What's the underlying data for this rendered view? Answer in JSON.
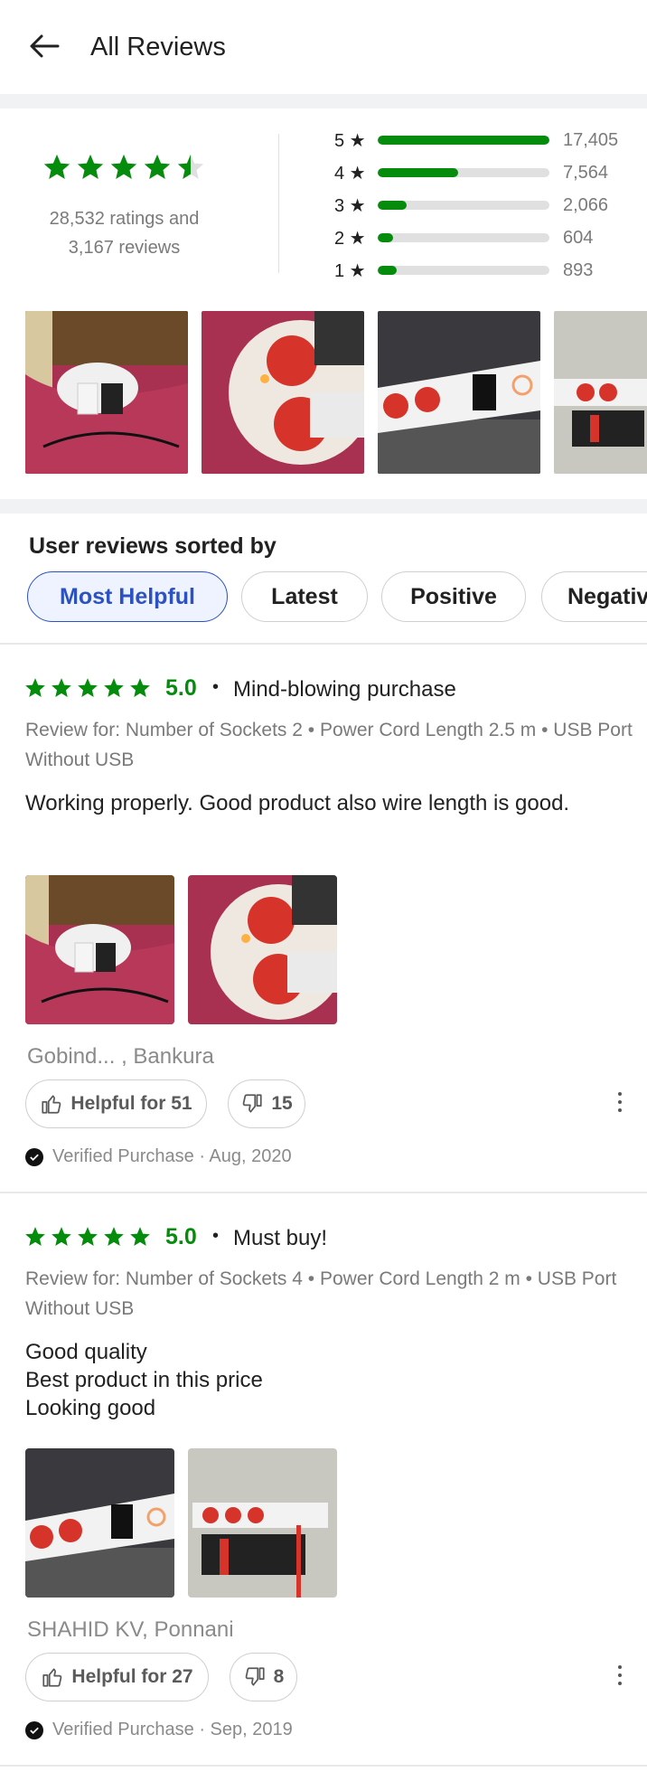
{
  "header": {
    "title": "All Reviews",
    "back_icon": "back-arrow-icon"
  },
  "summary": {
    "average_rating": 4.5,
    "ratings_line": "28,532 ratings and",
    "reviews_line": "3,167 reviews",
    "distribution": [
      {
        "label": "5 ★",
        "count": "17,405",
        "fraction": 1.0
      },
      {
        "label": "4 ★",
        "count": "7,564",
        "fraction": 0.47
      },
      {
        "label": "3 ★",
        "count": "2,066",
        "fraction": 0.17
      },
      {
        "label": "2 ★",
        "count": "604",
        "fraction": 0.09
      },
      {
        "label": "1 ★",
        "count": "893",
        "fraction": 0.11
      }
    ],
    "bar_color": "#058c0d"
  },
  "sort": {
    "title": "User reviews sorted by",
    "options": [
      "Most Helpful",
      "Latest",
      "Positive",
      "Negative"
    ],
    "selected": "Most Helpful"
  },
  "reviews": [
    {
      "rating": 5,
      "score": "5.0",
      "dot": "•",
      "title": "Mind-blowing purchase",
      "review_for": "Review for: Number of Sockets 2 • Power Cord Length 2.5 m • USB Port Without USB",
      "body_lines": [
        "Working properly. Good product also wire length is good."
      ],
      "reviewer": "Gobind... , Bankura",
      "helpful": "Helpful for 51",
      "not_helpful": "15",
      "verified": "Verified Purchase · Aug, 2020"
    },
    {
      "rating": 5,
      "score": "5.0",
      "dot": "•",
      "title": "Must buy!",
      "review_for": "Review for: Number of Sockets 4 • Power Cord Length 2 m • USB Port Without USB",
      "body_lines": [
        "Good quality",
        "Best product in this price",
        "Looking good"
      ],
      "reviewer": "SHAHID KV, Ponnani",
      "helpful": "Helpful for 27",
      "not_helpful": "8",
      "verified": "Verified Purchase · Sep, 2019"
    }
  ],
  "colors": {
    "accent_green": "#058c0d",
    "selected_chip": "#2b52c0"
  }
}
